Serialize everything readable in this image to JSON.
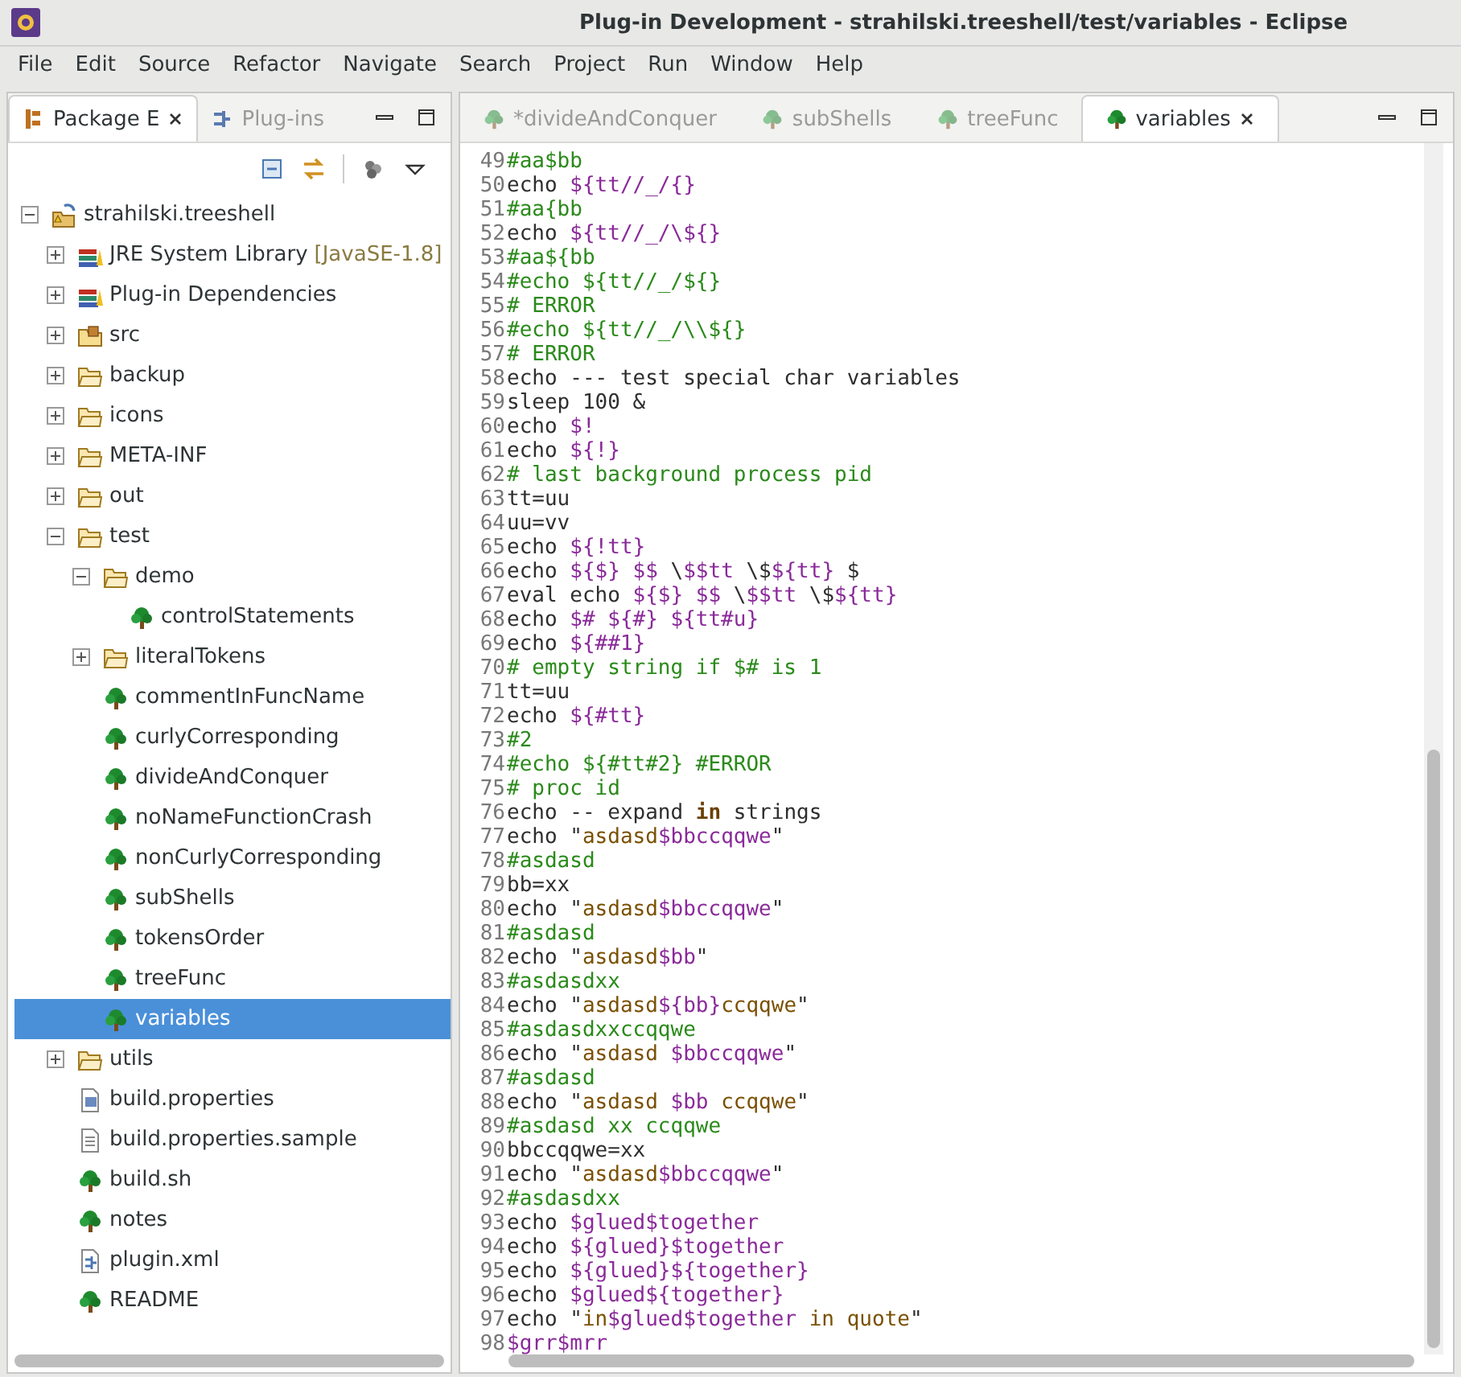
{
  "window": {
    "title": "Plug-in Development - strahilski.treeshell/test/variables - Eclipse"
  },
  "menu": [
    "File",
    "Edit",
    "Source",
    "Refactor",
    "Navigate",
    "Search",
    "Project",
    "Run",
    "Window",
    "Help"
  ],
  "explorer": {
    "tabs": [
      {
        "label": "Package E",
        "kind": "package",
        "selected": true
      },
      {
        "label": "Plug-ins",
        "kind": "plugins",
        "selected": false
      }
    ],
    "tree": {
      "label": "strahilski.treeshell",
      "kind": "project",
      "expanded": true,
      "selected": false,
      "children": [
        {
          "label": "JRE System Library",
          "decoration": "[JavaSE-1.8]",
          "kind": "library",
          "expanded": false,
          "selected": false
        },
        {
          "label": "Plug-in Dependencies",
          "kind": "library",
          "expanded": false,
          "selected": false
        },
        {
          "label": "src",
          "kind": "source",
          "expanded": false,
          "selected": false
        },
        {
          "label": "backup",
          "kind": "folder",
          "expanded": false,
          "selected": false
        },
        {
          "label": "icons",
          "kind": "folder",
          "expanded": false,
          "selected": false
        },
        {
          "label": "META-INF",
          "kind": "folder",
          "expanded": false,
          "selected": false
        },
        {
          "label": "out",
          "kind": "folder",
          "expanded": false,
          "selected": false
        },
        {
          "label": "test",
          "kind": "folder",
          "expanded": true,
          "selected": false,
          "children": [
            {
              "label": "demo",
              "kind": "folder",
              "expanded": true,
              "selected": false,
              "children": [
                {
                  "label": "controlStatements",
                  "kind": "script",
                  "selected": false
                }
              ]
            },
            {
              "label": "literalTokens",
              "kind": "folder",
              "expanded": false,
              "selected": false
            },
            {
              "label": "commentInFuncName",
              "kind": "script",
              "selected": false
            },
            {
              "label": "curlyCorresponding",
              "kind": "script",
              "selected": false
            },
            {
              "label": "divideAndConquer",
              "kind": "script",
              "selected": false
            },
            {
              "label": "noNameFunctionCrash",
              "kind": "script",
              "selected": false
            },
            {
              "label": "nonCurlyCorresponding",
              "kind": "script",
              "selected": false
            },
            {
              "label": "subShells",
              "kind": "script",
              "selected": false
            },
            {
              "label": "tokensOrder",
              "kind": "script",
              "selected": false
            },
            {
              "label": "treeFunc",
              "kind": "script",
              "selected": false
            },
            {
              "label": "variables",
              "kind": "script",
              "selected": true
            }
          ]
        },
        {
          "label": "utils",
          "kind": "folder",
          "expanded": false,
          "selected": false
        },
        {
          "label": "build.properties",
          "kind": "properties",
          "selected": false
        },
        {
          "label": "build.properties.sample",
          "kind": "text",
          "selected": false
        },
        {
          "label": "build.sh",
          "kind": "script",
          "selected": false
        },
        {
          "label": "notes",
          "kind": "script",
          "selected": false
        },
        {
          "label": "plugin.xml",
          "kind": "xml",
          "selected": false
        },
        {
          "label": "README",
          "kind": "script",
          "selected": false
        }
      ]
    }
  },
  "editor": {
    "tabs": [
      {
        "label": "*divideAndConquer",
        "selected": false
      },
      {
        "label": "subShells",
        "selected": false
      },
      {
        "label": "treeFunc",
        "selected": false
      },
      {
        "label": "variables",
        "selected": true
      }
    ],
    "lines": [
      {
        "n": "49",
        "segs": [
          {
            "kind": "comment",
            "text": "#aa$bb"
          }
        ]
      },
      {
        "n": "50",
        "segs": [
          {
            "kind": "plain",
            "text": "echo "
          },
          {
            "kind": "variable",
            "text": "${tt//_/{}"
          }
        ]
      },
      {
        "n": "51",
        "segs": [
          {
            "kind": "comment",
            "text": "#aa{bb"
          }
        ]
      },
      {
        "n": "52",
        "segs": [
          {
            "kind": "plain",
            "text": "echo "
          },
          {
            "kind": "variable",
            "text": "${tt//_/\\${}"
          }
        ]
      },
      {
        "n": "53",
        "segs": [
          {
            "kind": "comment",
            "text": "#aa${bb"
          }
        ]
      },
      {
        "n": "54",
        "segs": [
          {
            "kind": "comment",
            "text": "#echo ${tt//_/${}"
          }
        ]
      },
      {
        "n": "55",
        "segs": [
          {
            "kind": "comment",
            "text": "# ERROR"
          }
        ]
      },
      {
        "n": "56",
        "segs": [
          {
            "kind": "comment",
            "text": "#echo ${tt//_/\\\\${}"
          }
        ]
      },
      {
        "n": "57",
        "segs": [
          {
            "kind": "comment",
            "text": "# ERROR"
          }
        ]
      },
      {
        "n": "58",
        "segs": [
          {
            "kind": "plain",
            "text": "echo --- test special char variables"
          }
        ]
      },
      {
        "n": "59",
        "segs": [
          {
            "kind": "plain",
            "text": "sleep 100 &"
          }
        ]
      },
      {
        "n": "60",
        "segs": [
          {
            "kind": "plain",
            "text": "echo "
          },
          {
            "kind": "variable",
            "text": "$!"
          }
        ]
      },
      {
        "n": "61",
        "segs": [
          {
            "kind": "plain",
            "text": "echo "
          },
          {
            "kind": "variable",
            "text": "${!}"
          }
        ]
      },
      {
        "n": "62",
        "segs": [
          {
            "kind": "comment",
            "text": "# last background process pid"
          }
        ]
      },
      {
        "n": "63",
        "segs": [
          {
            "kind": "plain",
            "text": "tt=uu"
          }
        ]
      },
      {
        "n": "64",
        "segs": [
          {
            "kind": "plain",
            "text": "uu=vv"
          }
        ]
      },
      {
        "n": "65",
        "segs": [
          {
            "kind": "plain",
            "text": "echo "
          },
          {
            "kind": "variable",
            "text": "${!tt}"
          }
        ]
      },
      {
        "n": "66",
        "segs": [
          {
            "kind": "plain",
            "text": "echo "
          },
          {
            "kind": "variable",
            "text": "${$} $$"
          },
          {
            "kind": "plain",
            "text": " \\"
          },
          {
            "kind": "variable",
            "text": "$$tt"
          },
          {
            "kind": "plain",
            "text": " \\$"
          },
          {
            "kind": "variable",
            "text": "${tt}"
          },
          {
            "kind": "plain",
            "text": " $"
          }
        ]
      },
      {
        "n": "67",
        "segs": [
          {
            "kind": "plain",
            "text": "eval echo "
          },
          {
            "kind": "variable",
            "text": "${$} $$"
          },
          {
            "kind": "plain",
            "text": " \\"
          },
          {
            "kind": "variable",
            "text": "$$tt"
          },
          {
            "kind": "plain",
            "text": " \\$"
          },
          {
            "kind": "variable",
            "text": "${tt}"
          }
        ]
      },
      {
        "n": "68",
        "segs": [
          {
            "kind": "plain",
            "text": "echo "
          },
          {
            "kind": "variable",
            "text": "$# ${#} ${tt#u}"
          }
        ]
      },
      {
        "n": "69",
        "segs": [
          {
            "kind": "plain",
            "text": "echo "
          },
          {
            "kind": "variable",
            "text": "${##1}"
          }
        ]
      },
      {
        "n": "70",
        "segs": [
          {
            "kind": "comment",
            "text": "# empty string if $# is 1"
          }
        ]
      },
      {
        "n": "71",
        "segs": [
          {
            "kind": "plain",
            "text": "tt=uu"
          }
        ]
      },
      {
        "n": "72",
        "segs": [
          {
            "kind": "plain",
            "text": "echo "
          },
          {
            "kind": "variable",
            "text": "${#tt}"
          }
        ]
      },
      {
        "n": "73",
        "segs": [
          {
            "kind": "comment",
            "text": "#2"
          }
        ]
      },
      {
        "n": "74",
        "segs": [
          {
            "kind": "comment",
            "text": "#echo ${#tt#2} #ERROR"
          }
        ]
      },
      {
        "n": "75",
        "segs": [
          {
            "kind": "comment",
            "text": "# proc id"
          }
        ]
      },
      {
        "n": "76",
        "segs": [
          {
            "kind": "plain",
            "text": "echo -- expand "
          },
          {
            "kind": "keyword",
            "text": "in"
          },
          {
            "kind": "plain",
            "text": " strings"
          }
        ]
      },
      {
        "n": "77",
        "segs": [
          {
            "kind": "plain",
            "text": "echo \""
          },
          {
            "kind": "string",
            "text": "asdasd"
          },
          {
            "kind": "variable",
            "text": "$bbccqqwe"
          },
          {
            "kind": "plain",
            "text": "\""
          }
        ]
      },
      {
        "n": "78",
        "segs": [
          {
            "kind": "comment",
            "text": "#asdasd"
          }
        ]
      },
      {
        "n": "79",
        "segs": [
          {
            "kind": "plain",
            "text": "bb=xx"
          }
        ]
      },
      {
        "n": "80",
        "segs": [
          {
            "kind": "plain",
            "text": "echo \""
          },
          {
            "kind": "string",
            "text": "asdasd"
          },
          {
            "kind": "variable",
            "text": "$bbccqqwe"
          },
          {
            "kind": "plain",
            "text": "\""
          }
        ]
      },
      {
        "n": "81",
        "segs": [
          {
            "kind": "comment",
            "text": "#asdasd"
          }
        ]
      },
      {
        "n": "82",
        "segs": [
          {
            "kind": "plain",
            "text": "echo \""
          },
          {
            "kind": "string",
            "text": "asdasd"
          },
          {
            "kind": "variable",
            "text": "$bb"
          },
          {
            "kind": "plain",
            "text": "\""
          }
        ]
      },
      {
        "n": "83",
        "segs": [
          {
            "kind": "comment",
            "text": "#asdasdxx"
          }
        ]
      },
      {
        "n": "84",
        "segs": [
          {
            "kind": "plain",
            "text": "echo \""
          },
          {
            "kind": "string",
            "text": "asdasd"
          },
          {
            "kind": "variable",
            "text": "${bb}"
          },
          {
            "kind": "string",
            "text": "ccqqwe"
          },
          {
            "kind": "plain",
            "text": "\""
          }
        ]
      },
      {
        "n": "85",
        "segs": [
          {
            "kind": "comment",
            "text": "#asdasdxxccqqwe"
          }
        ]
      },
      {
        "n": "86",
        "segs": [
          {
            "kind": "plain",
            "text": "echo \""
          },
          {
            "kind": "string",
            "text": "asdasd "
          },
          {
            "kind": "variable",
            "text": "$bbccqqwe"
          },
          {
            "kind": "plain",
            "text": "\""
          }
        ]
      },
      {
        "n": "87",
        "segs": [
          {
            "kind": "comment",
            "text": "#asdasd"
          }
        ]
      },
      {
        "n": "88",
        "segs": [
          {
            "kind": "plain",
            "text": "echo \""
          },
          {
            "kind": "string",
            "text": "asdasd "
          },
          {
            "kind": "variable",
            "text": "$bb"
          },
          {
            "kind": "string",
            "text": " ccqqwe"
          },
          {
            "kind": "plain",
            "text": "\""
          }
        ]
      },
      {
        "n": "89",
        "segs": [
          {
            "kind": "comment",
            "text": "#asdasd xx ccqqwe"
          }
        ]
      },
      {
        "n": "90",
        "segs": [
          {
            "kind": "plain",
            "text": "bbccqqwe=xx"
          }
        ]
      },
      {
        "n": "91",
        "segs": [
          {
            "kind": "plain",
            "text": "echo \""
          },
          {
            "kind": "string",
            "text": "asdasd"
          },
          {
            "kind": "variable",
            "text": "$bbccqqwe"
          },
          {
            "kind": "plain",
            "text": "\""
          }
        ]
      },
      {
        "n": "92",
        "segs": [
          {
            "kind": "comment",
            "text": "#asdasdxx"
          }
        ]
      },
      {
        "n": "93",
        "segs": [
          {
            "kind": "plain",
            "text": "echo "
          },
          {
            "kind": "variable",
            "text": "$glued$together"
          }
        ]
      },
      {
        "n": "94",
        "segs": [
          {
            "kind": "plain",
            "text": "echo "
          },
          {
            "kind": "variable",
            "text": "${glued}$together"
          }
        ]
      },
      {
        "n": "95",
        "segs": [
          {
            "kind": "plain",
            "text": "echo "
          },
          {
            "kind": "variable",
            "text": "${glued}${together}"
          }
        ]
      },
      {
        "n": "96",
        "segs": [
          {
            "kind": "plain",
            "text": "echo "
          },
          {
            "kind": "variable",
            "text": "$glued${together}"
          }
        ]
      },
      {
        "n": "97",
        "segs": [
          {
            "kind": "plain",
            "text": "echo \""
          },
          {
            "kind": "string",
            "text": "in"
          },
          {
            "kind": "variable",
            "text": "$glued$together"
          },
          {
            "kind": "string",
            "text": " in quote"
          },
          {
            "kind": "plain",
            "text": "\""
          }
        ]
      },
      {
        "n": "98",
        "segs": [
          {
            "kind": "variable",
            "text": "$grr$mrr"
          }
        ]
      }
    ]
  }
}
